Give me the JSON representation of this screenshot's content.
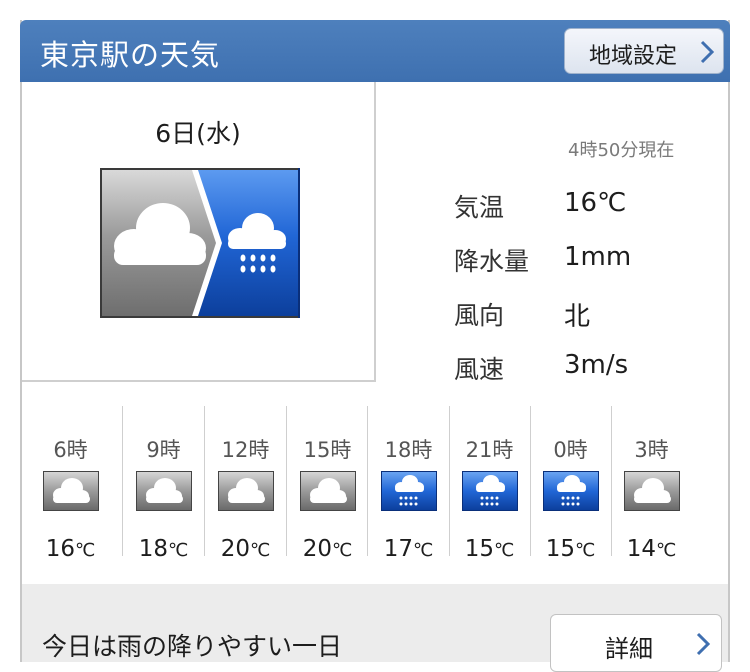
{
  "header": {
    "title": "東京駅の天気",
    "region_button": "地域設定"
  },
  "current": {
    "date": "6日(水)",
    "updated": "4時50分現在",
    "icon": "cloudy-then-rain-icon",
    "stats": [
      {
        "label": "気温",
        "value": "16℃"
      },
      {
        "label": "降水量",
        "value": "1mm"
      },
      {
        "label": "風向",
        "value": "北"
      },
      {
        "label": "風速",
        "value": "3m/s"
      }
    ]
  },
  "hourly": [
    {
      "time": "6時",
      "temp": "16",
      "unit": "℃",
      "icon": "cloud-icon"
    },
    {
      "time": "9時",
      "temp": "18",
      "unit": "℃",
      "icon": "cloud-icon"
    },
    {
      "time": "12時",
      "temp": "20",
      "unit": "℃",
      "icon": "cloud-icon"
    },
    {
      "time": "15時",
      "temp": "20",
      "unit": "℃",
      "icon": "cloud-icon"
    },
    {
      "time": "18時",
      "temp": "17",
      "unit": "℃",
      "icon": "rain-icon"
    },
    {
      "time": "21時",
      "temp": "15",
      "unit": "℃",
      "icon": "rain-icon"
    },
    {
      "time": "0時",
      "temp": "15",
      "unit": "℃",
      "icon": "rain-icon"
    },
    {
      "time": "3時",
      "temp": "14",
      "unit": "℃",
      "icon": "cloud-icon"
    }
  ],
  "footer": {
    "summary": "今日は雨の降りやすい一日",
    "detail_button": "詳細"
  },
  "colors": {
    "header_blue": "#4478b8",
    "rain_blue": "#1b5ec9",
    "cloud_gray": "#8a8a8a",
    "accent_chevron": "#3f6fb0"
  }
}
